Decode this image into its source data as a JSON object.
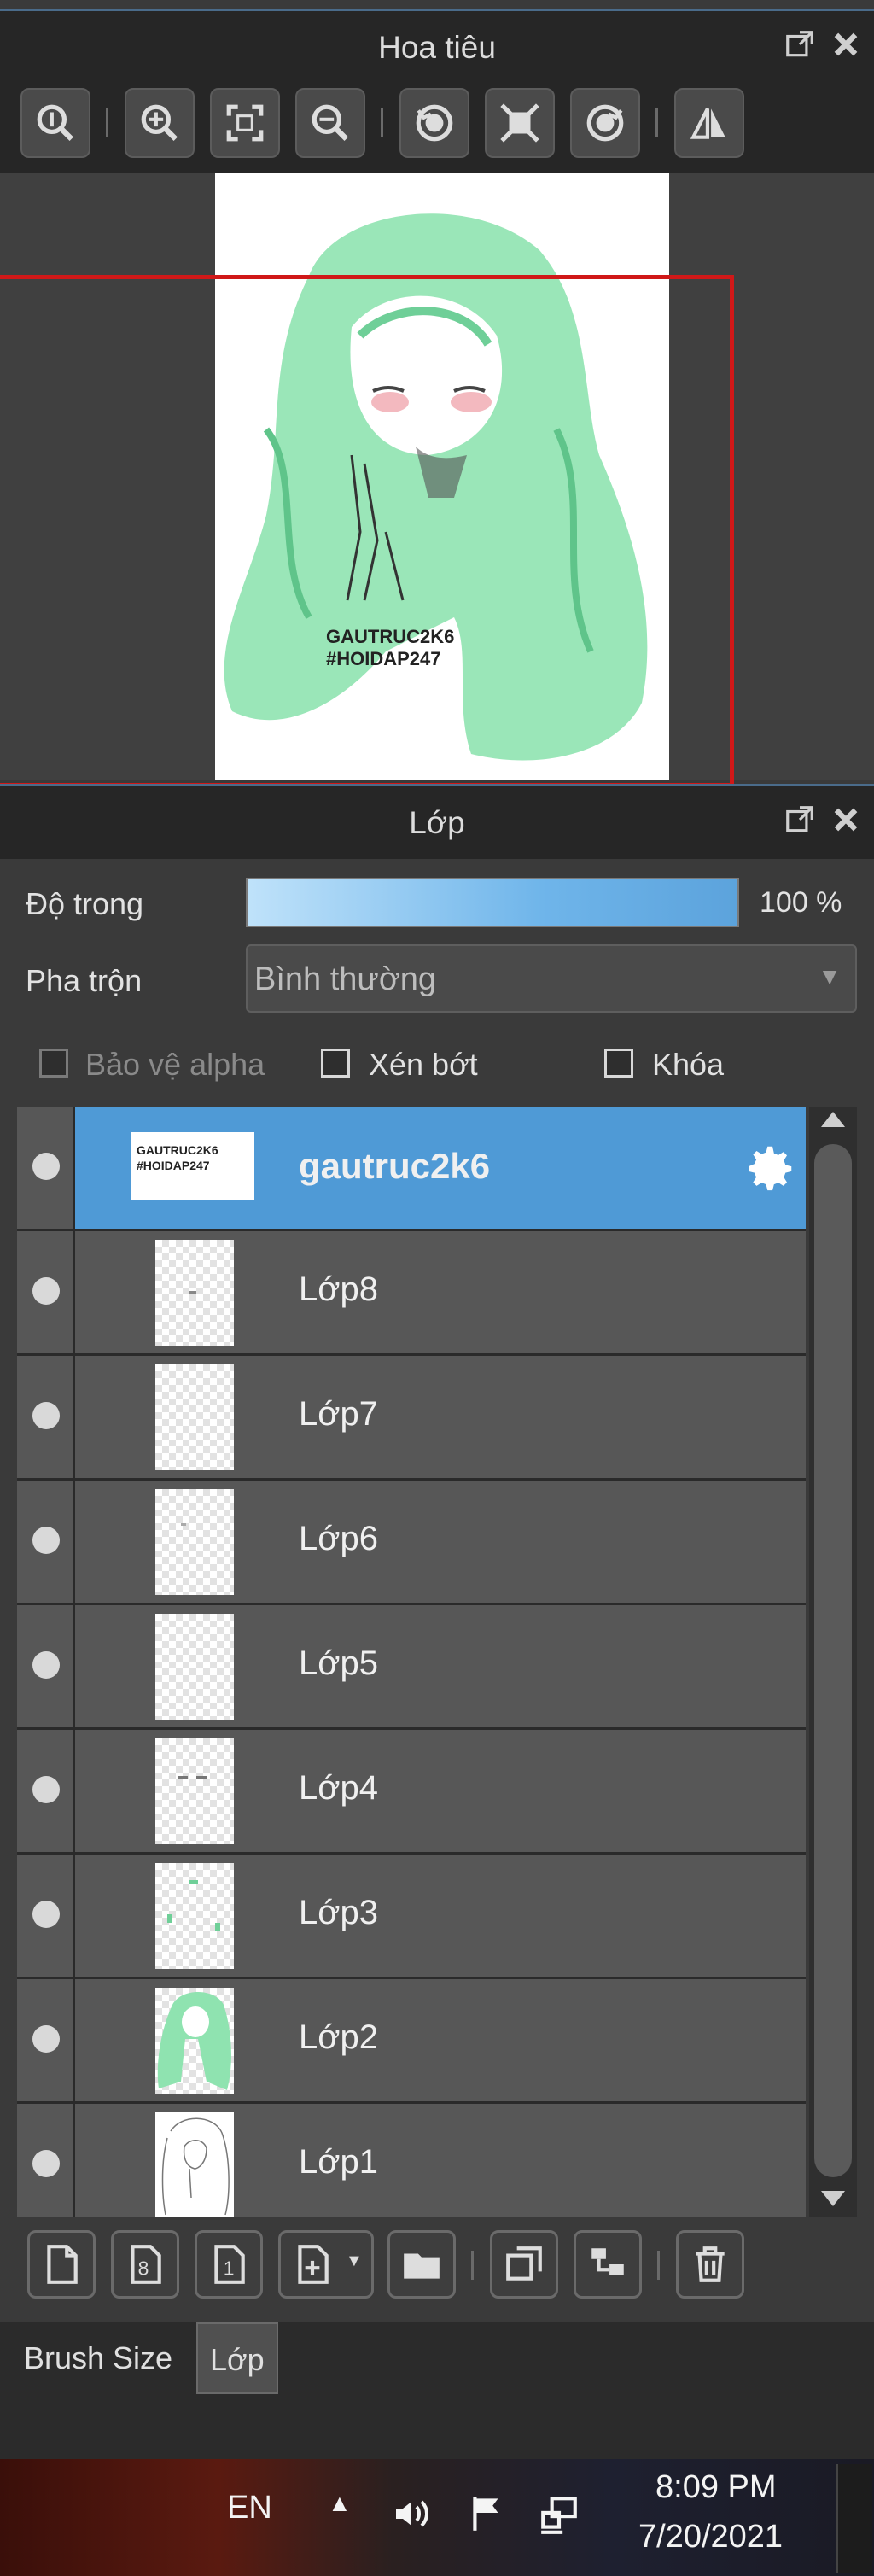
{
  "navigator": {
    "title": "Hoa tiêu",
    "artwork_text": [
      "GAUTRUC2K6",
      "#HOIDAP247"
    ]
  },
  "layers_panel": {
    "title": "Lớp",
    "opacity_label": "Độ trong",
    "opacity_value": "100 %",
    "opacity": 1.0,
    "blend_label": "Pha trộn",
    "blend_value": "Bình thường",
    "protect_alpha_label": "Bảo vệ alpha",
    "clip_label": "Xén bớt",
    "lock_label": "Khóa",
    "layers": [
      {
        "name": "gautruc2k6",
        "selected": true
      },
      {
        "name": "Lớp8",
        "selected": false
      },
      {
        "name": "Lớp7",
        "selected": false
      },
      {
        "name": "Lớp6",
        "selected": false
      },
      {
        "name": "Lớp5",
        "selected": false
      },
      {
        "name": "Lớp4",
        "selected": false
      },
      {
        "name": "Lớp3",
        "selected": false
      },
      {
        "name": "Lớp2",
        "selected": false
      },
      {
        "name": "Lớp1",
        "selected": false
      }
    ]
  },
  "tabs": {
    "brush_size": "Brush Size",
    "layer": "Lớp"
  },
  "taskbar": {
    "language": "EN",
    "time": "8:09 PM",
    "date": "7/20/2021"
  },
  "colors": {
    "accent": "#4f9ad6",
    "hair": "#8fe3b0",
    "red_frame": "#d01818"
  }
}
